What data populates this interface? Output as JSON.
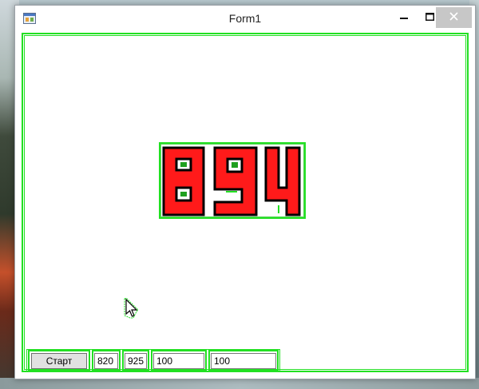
{
  "window": {
    "title": "Form1"
  },
  "titlebar_buttons": {
    "minimize_icon": "minimize-icon",
    "maximize_icon": "maximize-icon",
    "close_icon": "close-icon"
  },
  "display": {
    "digits": "894",
    "digit_fill_color": "#ff1a1a",
    "digit_outline_color": "#000000",
    "detection_outline_color": "#22e022"
  },
  "controls": {
    "start_label": "Старт",
    "field1_value": "820",
    "field2_value": "925",
    "field3_value": "100",
    "field4_value": "100"
  }
}
